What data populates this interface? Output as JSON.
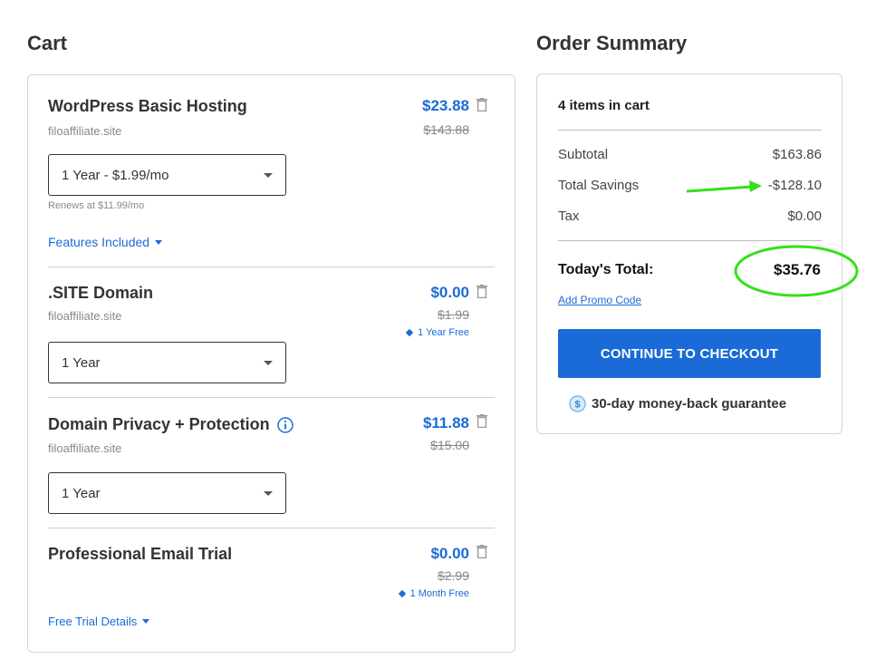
{
  "cart": {
    "heading": "Cart",
    "items": [
      {
        "title": "WordPress Basic Hosting",
        "domain": "filoaffiliate.site",
        "price": "$23.88",
        "old_price": "$143.88",
        "term": "1 Year - $1.99/mo",
        "renews": "Renews at $11.99/mo",
        "link": "Features Included"
      },
      {
        "title": ".SITE Domain",
        "domain": "filoaffiliate.site",
        "price": "$0.00",
        "old_price": "$1.99",
        "badge": "1 Year Free",
        "term": "1 Year"
      },
      {
        "title": "Domain Privacy + Protection",
        "domain": "filoaffiliate.site",
        "price": "$11.88",
        "old_price": "$15.00",
        "term": "1 Year"
      },
      {
        "title": "Professional Email Trial",
        "price": "$0.00",
        "old_price": "$2.99",
        "badge": "1 Month Free",
        "link": "Free Trial Details"
      }
    ]
  },
  "summary": {
    "heading": "Order Summary",
    "items_count": "4 items in cart",
    "subtotal_label": "Subtotal",
    "subtotal_value": "$163.86",
    "savings_label": "Total Savings",
    "savings_value": "-$128.10",
    "tax_label": "Tax",
    "tax_value": "$0.00",
    "total_label": "Today's Total:",
    "total_value": "$35.76",
    "promo_link": "Add Promo Code",
    "checkout_button": "CONTINUE TO CHECKOUT",
    "guarantee": "30-day money-back guarantee"
  },
  "annotations": {
    "arrow_color": "#35e01a",
    "circle_color": "#35e01a"
  },
  "colors": {
    "accent": "#1a6ad8"
  }
}
